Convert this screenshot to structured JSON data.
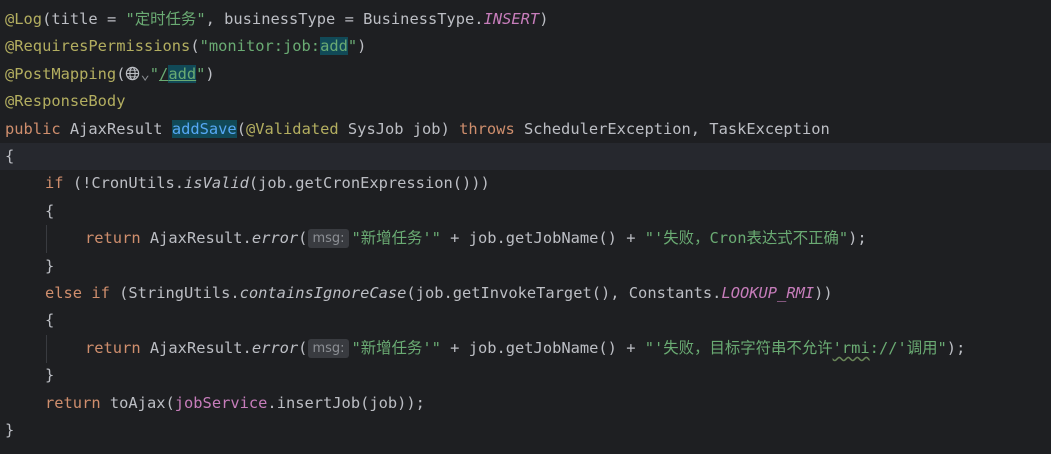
{
  "code": {
    "l1": {
      "ann": "@Log",
      "open": "(title = ",
      "title_str": "\"定时任务\"",
      "mid": ", businessType = BusinessType.",
      "const": "INSERT",
      "close": ")"
    },
    "l2": {
      "ann": "@RequiresPermissions",
      "open": "(",
      "str_a": "\"monitor:job:",
      "str_hl": "add",
      "str_b": "\"",
      "close": ")"
    },
    "l3": {
      "ann": "@PostMapping",
      "open": "(",
      "chevron": "⌄",
      "q1": "\"",
      "url_a": "/",
      "url_hl": "add",
      "q2": "\"",
      "close": ")"
    },
    "l4": {
      "ann": "@ResponseBody"
    },
    "l5": {
      "kw": "public",
      "type": " AjaxResult ",
      "method": "addSave",
      "open": "(",
      "ann": "@Validated",
      "params": " SysJob job) ",
      "throws": "throws",
      "exc": " SchedulerException, TaskException"
    },
    "l6": {
      "brace": "{"
    },
    "l7": {
      "kw": "if",
      "a": " (!CronUtils.",
      "m": "isValid",
      "b": "(job.getCronExpression()))"
    },
    "l8": {
      "brace": "{"
    },
    "l9": {
      "kw": "return",
      "a": " AjaxResult.",
      "m": "error",
      "open": "(",
      "hint": "msg:",
      "s1": "\"新增任务'\"",
      "mid": " + job.getJobName() + ",
      "s2": "\"'失败，Cron表达式不正确\"",
      "end": ");"
    },
    "l10": {
      "brace": "}"
    },
    "l11": {
      "kw": "else if",
      "a": " (StringUtils.",
      "m": "containsIgnoreCase",
      "b": "(job.getInvokeTarget(), Constants.",
      "c": "LOOKUP_RMI",
      "d": "))"
    },
    "l12": {
      "brace": "{"
    },
    "l13": {
      "kw": "return",
      "a": " AjaxResult.",
      "m": "error",
      "open": "(",
      "hint": "msg:",
      "s1": "\"新增任务'\"",
      "mid": " + job.getJobName() + ",
      "s2a": "\"'失败，目标字符串不允许",
      "s2b": "'rmi",
      "s2c": "://'调用\"",
      "end": ");"
    },
    "l14": {
      "brace": "}"
    },
    "l15": {
      "kw": "return",
      "a": " toAjax(",
      "field": "jobService",
      "b": ".insertJob(job));"
    },
    "l16": {
      "brace": "}"
    }
  },
  "colors": {
    "background": "#1e1f22",
    "current_line": "#26282e",
    "annotation": "#b3ae60",
    "string": "#6aab73",
    "keyword": "#cf8e6d",
    "constant": "#c77dbb",
    "method_declaration": "#56a8f5",
    "identifier_highlight": "#114957",
    "default_text": "#bcbec4"
  }
}
